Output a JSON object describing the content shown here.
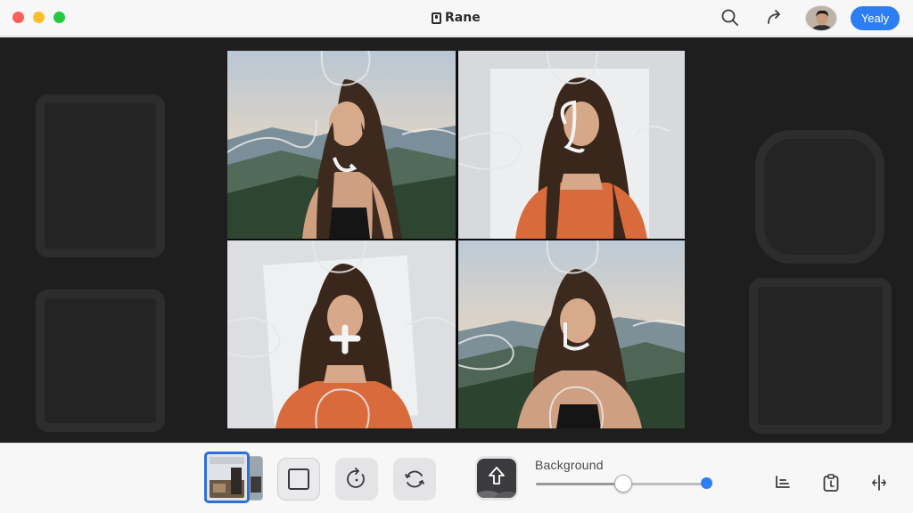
{
  "window": {
    "title": "Rane",
    "account_button_label": "Yealy"
  },
  "icons": {
    "title_bar": [
      "close-icon",
      "minimize-icon",
      "zoom-icon",
      "app-logo-icon",
      "search-icon",
      "share-icon",
      "avatar"
    ],
    "toolbar": [
      "square-crop-icon",
      "rotate-icon",
      "reset-icon",
      "upload-icon",
      "layers-icon",
      "clipboard-icon",
      "split-icon"
    ]
  },
  "canvas": {
    "pieces": [
      "puzzle-piece-1",
      "puzzle-piece-2",
      "puzzle-piece-3",
      "puzzle-piece-4"
    ]
  },
  "toolbar": {
    "slider_label": "Background",
    "slider_value": 0.5
  },
  "colors": {
    "accent": "#2d7ef2",
    "traffic_red": "#fe5f57",
    "traffic_yellow": "#febc2e",
    "traffic_green": "#28c840",
    "canvas_background": "#1e1e1e",
    "toolbar_background": "#f7f7f8"
  }
}
